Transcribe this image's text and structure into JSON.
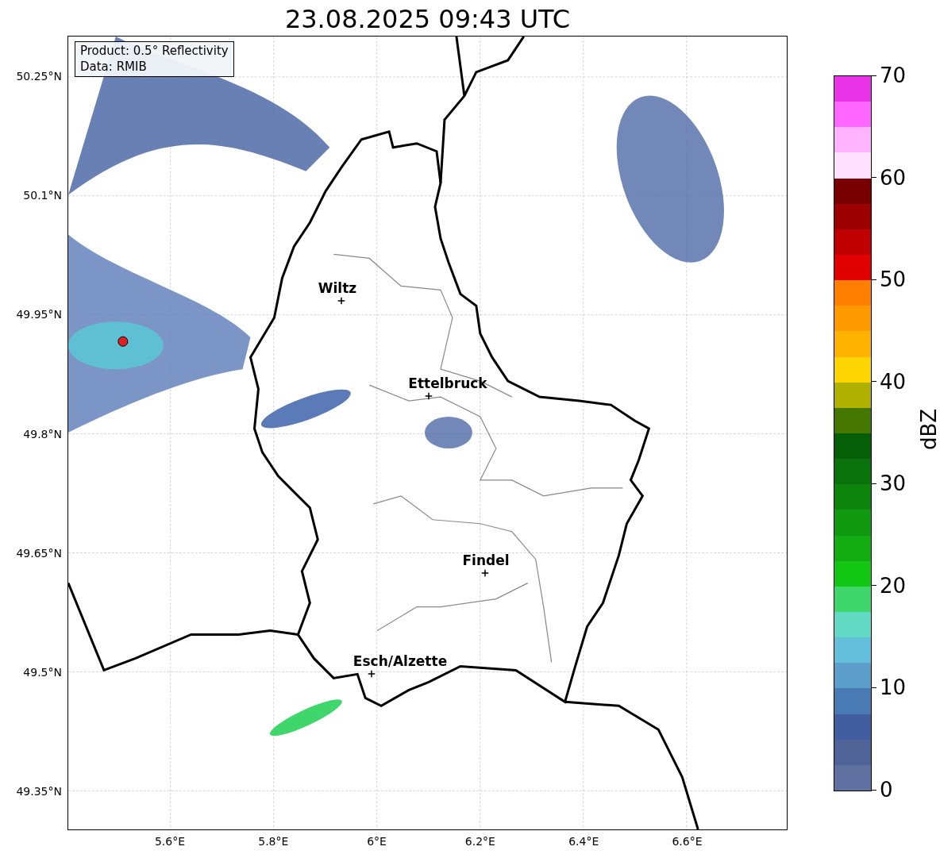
{
  "title": "23.08.2025 09:43 UTC",
  "map": {
    "legend": [
      "Product: 0.5° Reflectivity",
      "Data: RMIB"
    ],
    "cities": [
      {
        "name": "Wiltz"
      },
      {
        "name": "Ettelbruck"
      },
      {
        "name": "Findel"
      },
      {
        "name": "Esch/Alzette"
      }
    ],
    "xticks": [
      "5.6°E",
      "5.8°E",
      "6°E",
      "6.2°E",
      "6.4°E",
      "6.6°E"
    ],
    "yticks": [
      "50.25°N",
      "50.1°N",
      "49.95°N",
      "49.8°N",
      "49.65°N",
      "49.5°N",
      "49.35°N"
    ]
  },
  "colorbar": {
    "label": "dBZ",
    "ticks": [
      "70",
      "60",
      "50",
      "40",
      "30",
      "20",
      "10",
      "0"
    ],
    "segments": [
      {
        "color": "#e833e8"
      },
      {
        "color": "#ff66ff"
      },
      {
        "color": "#ffb3ff"
      },
      {
        "color": "#ffe0ff"
      },
      {
        "color": "#780000"
      },
      {
        "color": "#9c0000"
      },
      {
        "color": "#c00000"
      },
      {
        "color": "#e00000"
      },
      {
        "color": "#ff7f00"
      },
      {
        "color": "#ff9900"
      },
      {
        "color": "#ffb300"
      },
      {
        "color": "#ffd500"
      },
      {
        "color": "#b0b000"
      },
      {
        "color": "#457700"
      },
      {
        "color": "#065f06"
      },
      {
        "color": "#0a720a"
      },
      {
        "color": "#0d850d"
      },
      {
        "color": "#119911"
      },
      {
        "color": "#13ad13"
      },
      {
        "color": "#14c614"
      },
      {
        "color": "#3fd66b"
      },
      {
        "color": "#62d9c3"
      },
      {
        "color": "#64bfdc"
      },
      {
        "color": "#5a9ec9"
      },
      {
        "color": "#4a7ab3"
      },
      {
        "color": "#415ea0"
      },
      {
        "color": "#4f6399"
      },
      {
        "color": "#6070a0"
      }
    ]
  }
}
